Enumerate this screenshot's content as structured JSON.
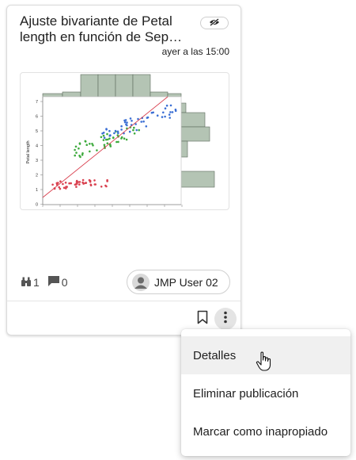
{
  "card": {
    "title": "Ajuste bivariante de Petal length en función de Sepal length",
    "timestamp": "ayer a las 15:00",
    "visibility_icon": "eye-off-icon",
    "stats": {
      "views_icon": "binoculars-icon",
      "views": "1",
      "comments_icon": "comment-icon",
      "comments": "0"
    },
    "user": {
      "name": "JMP User 02",
      "avatar_icon": "person-icon"
    },
    "actions": {
      "bookmark_icon": "bookmark-icon",
      "more_icon": "more-vertical-icon"
    }
  },
  "thumbnail": {
    "y_axis_label": "Petal length",
    "y_ticks": [
      "7",
      "6",
      "5",
      "4",
      "3",
      "2",
      "1",
      "0"
    ],
    "colors": {
      "setosa": "#d9404f",
      "versicolor": "#3daa3d",
      "virginica": "#3b6fd4",
      "fit_line": "#d9404f",
      "histogram": "#b4c4b4"
    }
  },
  "menu": {
    "items": [
      {
        "label": "Detalles"
      },
      {
        "label": "Eliminar publicación"
      },
      {
        "label": "Marcar como inapropiado"
      }
    ]
  }
}
